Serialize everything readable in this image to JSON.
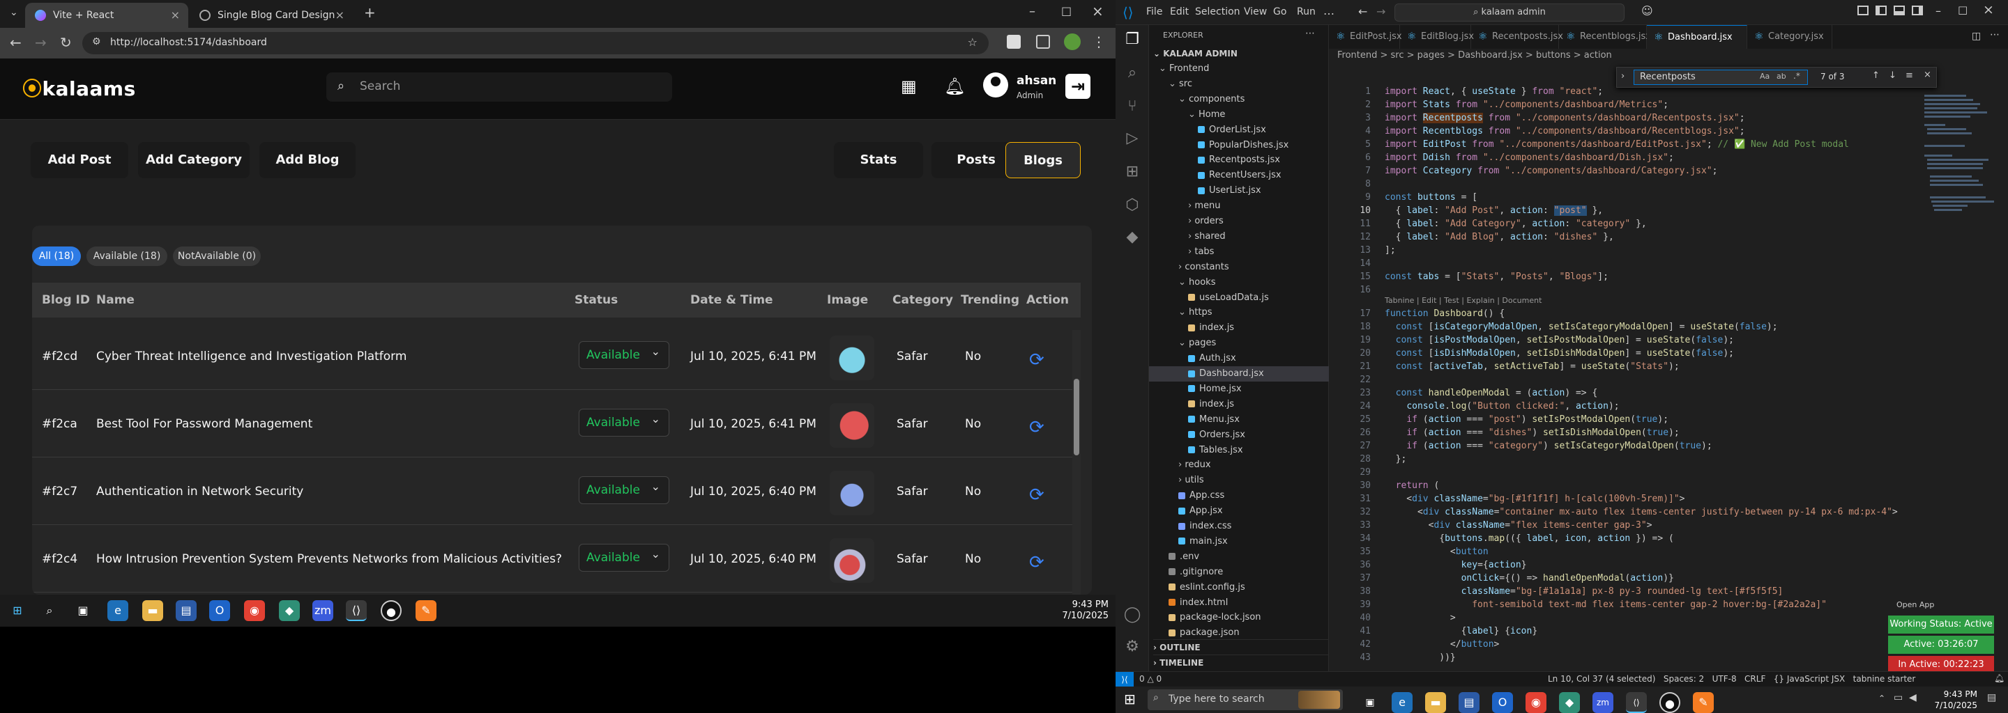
{
  "browser": {
    "tabs": [
      {
        "title": "Vite + React",
        "active": true
      },
      {
        "title": "Single Blog Card Design",
        "active": false
      }
    ],
    "url": "http://localhost:5174/dashboard"
  },
  "app": {
    "logo": "kalaams",
    "search_placeholder": "Search",
    "user_name": "ahsan",
    "user_role": "Admin",
    "actions": [
      "Add Post",
      "Add Category",
      "Add Blog"
    ],
    "tabs": [
      "Stats",
      "Posts",
      "Blogs"
    ],
    "active_tab": "Blogs",
    "filters": [
      "All (18)",
      "Available (18)",
      "NotAvailable (0)"
    ],
    "columns": [
      "Blog ID",
      "Name",
      "Status",
      "Date & Time",
      "Image",
      "Category",
      "Trending",
      "Action"
    ],
    "rows": [
      {
        "id": "#f2cd",
        "name": "Cyber Threat Intelligence and Investigation Platform",
        "status": "Available",
        "date": "Jul 10, 2025, 6:41 PM",
        "category": "Safar",
        "trending": "No"
      },
      {
        "id": "#f2ca",
        "name": "Best Tool For Password Management",
        "status": "Available",
        "date": "Jul 10, 2025, 6:41 PM",
        "category": "Safar",
        "trending": "No"
      },
      {
        "id": "#f2c7",
        "name": "Authentication in Network Security",
        "status": "Available",
        "date": "Jul 10, 2025, 6:40 PM",
        "category": "Safar",
        "trending": "No"
      },
      {
        "id": "#f2c4",
        "name": "How Intrusion Prevention System Prevents Networks from Malicious Activities?",
        "status": "Available",
        "date": "Jul 10, 2025, 6:40 PM",
        "category": "Safar",
        "trending": "No"
      }
    ]
  },
  "taskbar_left": {
    "time": "9:43 PM",
    "date": "7/10/2025"
  },
  "vscode": {
    "menus": [
      "File",
      "Edit",
      "Selection",
      "View",
      "Go",
      "Run"
    ],
    "command_center": "kalaam admin",
    "explorer_title": "EXPLORER",
    "root": "KALAAM ADMIN",
    "tree": [
      {
        "label": "Frontend",
        "indent": 0,
        "type": "folder"
      },
      {
        "label": "src",
        "indent": 1,
        "type": "folder"
      },
      {
        "label": "components",
        "indent": 2,
        "type": "folder"
      },
      {
        "label": "Home",
        "indent": 3,
        "type": "folder"
      },
      {
        "label": "OrderList.jsx",
        "indent": 4,
        "type": "jsx"
      },
      {
        "label": "PopularDishes.jsx",
        "indent": 4,
        "type": "jsx"
      },
      {
        "label": "Recentposts.jsx",
        "indent": 4,
        "type": "jsx"
      },
      {
        "label": "RecentUsers.jsx",
        "indent": 4,
        "type": "jsx"
      },
      {
        "label": "UserList.jsx",
        "indent": 4,
        "type": "jsx"
      },
      {
        "label": "menu",
        "indent": 3,
        "type": "folder"
      },
      {
        "label": "orders",
        "indent": 3,
        "type": "folder"
      },
      {
        "label": "shared",
        "indent": 3,
        "type": "folder"
      },
      {
        "label": "tabs",
        "indent": 3,
        "type": "folder"
      },
      {
        "label": "constants",
        "indent": 2,
        "type": "folder"
      },
      {
        "label": "hooks",
        "indent": 2,
        "type": "folder"
      },
      {
        "label": "useLoadData.js",
        "indent": 3,
        "type": "js"
      },
      {
        "label": "https",
        "indent": 2,
        "type": "folder"
      },
      {
        "label": "index.js",
        "indent": 3,
        "type": "js"
      },
      {
        "label": "pages",
        "indent": 2,
        "type": "folder"
      },
      {
        "label": "Auth.jsx",
        "indent": 3,
        "type": "jsx"
      },
      {
        "label": "Dashboard.jsx",
        "indent": 3,
        "type": "jsx",
        "selected": true
      },
      {
        "label": "Home.jsx",
        "indent": 3,
        "type": "jsx"
      },
      {
        "label": "index.js",
        "indent": 3,
        "type": "js"
      },
      {
        "label": "Menu.jsx",
        "indent": 3,
        "type": "jsx"
      },
      {
        "label": "Orders.jsx",
        "indent": 3,
        "type": "jsx"
      },
      {
        "label": "Tables.jsx",
        "indent": 3,
        "type": "jsx"
      },
      {
        "label": "redux",
        "indent": 2,
        "type": "folder"
      },
      {
        "label": "utils",
        "indent": 2,
        "type": "folder"
      },
      {
        "label": "App.css",
        "indent": 2,
        "type": "css"
      },
      {
        "label": "App.jsx",
        "indent": 2,
        "type": "jsx"
      },
      {
        "label": "index.css",
        "indent": 2,
        "type": "css"
      },
      {
        "label": "main.jsx",
        "indent": 2,
        "type": "jsx"
      },
      {
        "label": ".env",
        "indent": 1,
        "type": "file"
      },
      {
        "label": ".gitignore",
        "indent": 1,
        "type": "file"
      },
      {
        "label": "eslint.config.js",
        "indent": 1,
        "type": "js"
      },
      {
        "label": "index.html",
        "indent": 1,
        "type": "html"
      },
      {
        "label": "package-lock.json",
        "indent": 1,
        "type": "json"
      },
      {
        "label": "package.json",
        "indent": 1,
        "type": "json"
      }
    ],
    "outline": "OUTLINE",
    "timeline": "TIMELINE",
    "editor_tabs": [
      "EditPost.jsx",
      "EditBlog.jsx",
      "Recentposts.jsx",
      "Recentblogs.jsx",
      "Dashboard.jsx",
      "Category.jsx"
    ],
    "active_editor": "Dashboard.jsx",
    "breadcrumb": "Frontend > src > pages > Dashboard.jsx > buttons > action",
    "find_query": "Recentposts",
    "find_count": "7 of 3",
    "codelens": "Tabnine | Edit | Test | Explain | Document",
    "status_right": "Ln 10, Col 37 (4 selected)   Spaces: 2   UTF-8   CRLF   {} JavaScript JSX   tabnine starter",
    "status_left": "0 △ 0",
    "working_status": "Working Status: Active",
    "active_time": "Active: 03:26:07",
    "inactive_time": "In Active: 00:22:23",
    "open_app": "Open App",
    "win_search": "Type here to search",
    "win_time": "9:43 PM",
    "win_date": "7/10/2025"
  }
}
